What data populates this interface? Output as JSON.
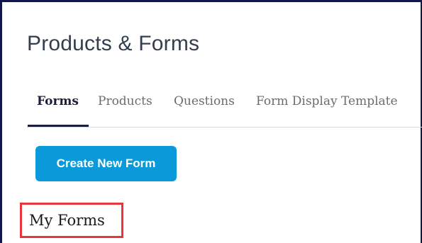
{
  "page": {
    "title": "Products & Forms"
  },
  "tabs": [
    {
      "label": "Forms",
      "active": true
    },
    {
      "label": "Products",
      "active": false
    },
    {
      "label": "Questions",
      "active": false
    },
    {
      "label": "Form Display Template",
      "active": false
    }
  ],
  "actions": {
    "create_form_label": "Create New Form"
  },
  "section": {
    "title": "My Forms",
    "highlight_color": "#e8373c"
  },
  "colors": {
    "accent": "#0a9ad9",
    "frame": "#12164a",
    "active_tab": "#1b1f3b"
  }
}
